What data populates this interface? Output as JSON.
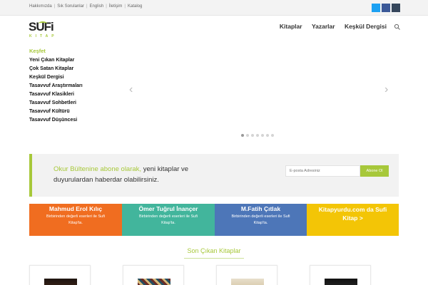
{
  "topbar": {
    "links": [
      "Hakkımızda",
      "Sık Sorulanlar",
      "English",
      "İletişim",
      "Katalog"
    ],
    "separator": "|",
    "social": [
      {
        "icon": "twitter-icon",
        "color": "#1da1f2"
      },
      {
        "icon": "facebook-icon",
        "color": "#3b5998"
      },
      {
        "icon": "instagram-icon",
        "color": "#35465c"
      }
    ]
  },
  "header": {
    "logo_text": "SUFi",
    "logo_subtext": "KITAP",
    "nav": [
      "Kitaplar",
      "Yazarlar",
      "Keşkül Dergisi"
    ],
    "search_icon": "search-icon"
  },
  "hero": {
    "category_title": "Keşfet",
    "categories": [
      "Yeni Çıkan Kitaplar",
      "Çok Satan Kitaplar",
      "Keşkül Dergisi",
      "Tasavvuf Araştırmaları",
      "Tasavvuf Klasikleri",
      "Tasavvuf Sohbetleri",
      "Tasavvuf Kültürü",
      "Tasavvuf Düşüncesi"
    ],
    "prev_arrow": "‹",
    "next_arrow": "›",
    "slide_count": 7,
    "active_slide": 1
  },
  "newsletter": {
    "highlight": "Okur Bültenine abone olarak,",
    "text": " yeni kitaplar ve duyurulardan haberdar olabilirsiniz.",
    "placeholder": "E-posta Adresiniz",
    "button_label": "Abone Ol"
  },
  "cards": [
    {
      "title": "Mahmud Erol Kılıç",
      "desc": "Birbirinden değerli eserleri ile Sufi Kitap'ta.",
      "color": "#f06d20"
    },
    {
      "title": "Ömer Tuğrul İnançer",
      "desc": "Birbirinden değerli eserleri ile Sufi Kitap'ta.",
      "color": "#42b59c"
    },
    {
      "title": "M.Fatih Çıtlak",
      "desc": "Birbirinden değerli eserleri ile Sufi Kitap'ta.",
      "color": "#4d76b8"
    },
    {
      "title": "Kitapyurdu.com da Sufi Kitap >",
      "desc": "",
      "color": "#f3c506"
    }
  ],
  "recent": {
    "title": "Son Çıkan Kitaplar"
  },
  "colors": {
    "accent": "#a7c83a"
  }
}
